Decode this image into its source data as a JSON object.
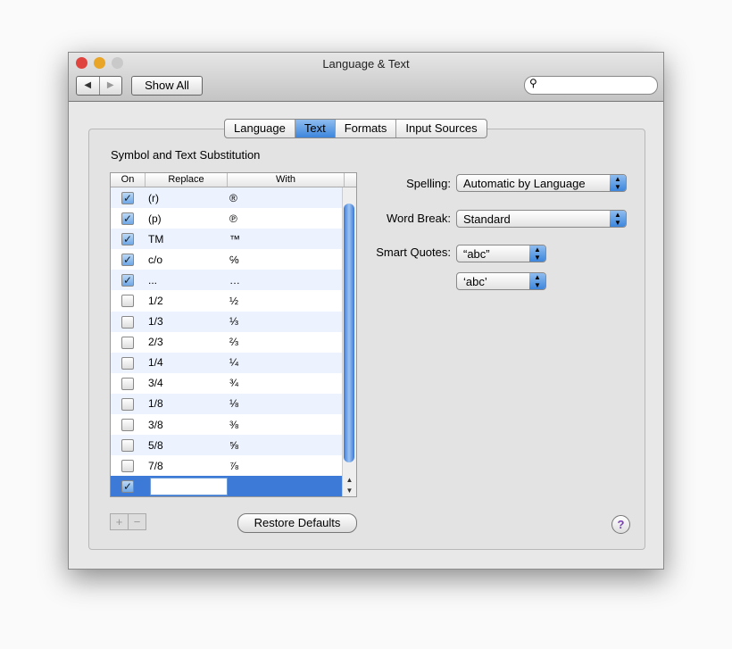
{
  "window": {
    "title": "Language & Text",
    "show_all": "Show All",
    "back_icon": "◀",
    "forward_icon": "▶",
    "search_icon": "⚲",
    "search_placeholder": ""
  },
  "tabs": [
    {
      "label": "Language"
    },
    {
      "label": "Text",
      "selected": true
    },
    {
      "label": "Formats"
    },
    {
      "label": "Input Sources"
    }
  ],
  "group_title": "Symbol and Text Substitution",
  "table": {
    "headers": [
      "On",
      "Replace",
      "With"
    ],
    "rows": [
      {
        "on": true,
        "replace": "(r)",
        "with": "®"
      },
      {
        "on": true,
        "replace": "(p)",
        "with": "℗"
      },
      {
        "on": true,
        "replace": "TM",
        "with": "™"
      },
      {
        "on": true,
        "replace": "c/o",
        "with": "℅"
      },
      {
        "on": true,
        "replace": "...",
        "with": "…"
      },
      {
        "on": false,
        "replace": "1/2",
        "with": "½"
      },
      {
        "on": false,
        "replace": "1/3",
        "with": "⅓"
      },
      {
        "on": false,
        "replace": "2/3",
        "with": "⅔"
      },
      {
        "on": false,
        "replace": "1/4",
        "with": "¼"
      },
      {
        "on": false,
        "replace": "3/4",
        "with": "¾"
      },
      {
        "on": false,
        "replace": "1/8",
        "with": "⅛"
      },
      {
        "on": false,
        "replace": "3/8",
        "with": "⅜"
      },
      {
        "on": false,
        "replace": "5/8",
        "with": "⅝"
      },
      {
        "on": false,
        "replace": "7/8",
        "with": "⅞"
      },
      {
        "on": true,
        "replace": "",
        "with": "",
        "selected": true
      }
    ]
  },
  "settings": {
    "spelling_label": "Spelling:",
    "spelling_value": "Automatic by Language",
    "word_break_label": "Word Break:",
    "word_break_value": "Standard",
    "smart_quotes_label": "Smart Quotes:",
    "double_quotes_value": "“abc”",
    "single_quotes_value": "‘abc’"
  },
  "buttons": {
    "add": "+",
    "remove": "−",
    "restore": "Restore Defaults",
    "help": "?"
  },
  "colors": {
    "accent": "#3d79d6",
    "close": "#e0443e",
    "minimize": "#e8a528"
  }
}
